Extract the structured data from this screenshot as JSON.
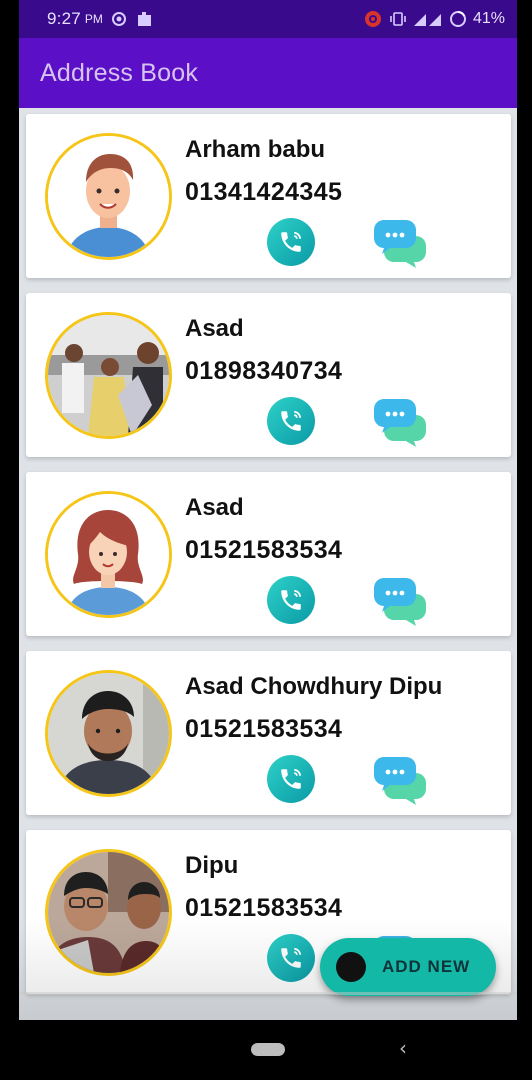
{
  "status_bar": {
    "time": "9:27",
    "ampm": "PM",
    "battery": "41%"
  },
  "app": {
    "title": "Address Book"
  },
  "contacts": [
    {
      "name": "Arham babu",
      "phone": "01341424345",
      "avatar": "male-cartoon"
    },
    {
      "name": "Asad",
      "phone": "01898340734",
      "avatar": "group-photo"
    },
    {
      "name": "Asad",
      "phone": "01521583534",
      "avatar": "female-cartoon"
    },
    {
      "name": "Asad Chowdhury Dipu",
      "phone": "01521583534",
      "avatar": "man-photo"
    },
    {
      "name": "Dipu",
      "phone": "01521583534",
      "avatar": "selfie-photo"
    }
  ],
  "fab": {
    "label": "ADD NEW"
  },
  "colors": {
    "status_bar": "#3a0a8c",
    "app_bar": "#5b0fc6",
    "avatar_ring": "#f5c518",
    "call_button": "#14b8c4",
    "fab": "#14b8a6"
  }
}
